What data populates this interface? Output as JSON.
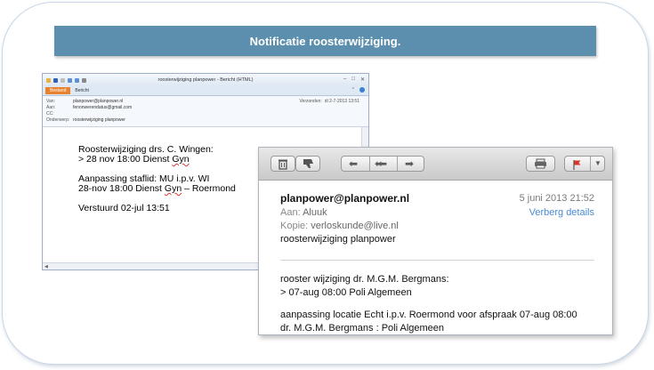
{
  "slide": {
    "title": "Notificatie roosterwijziging."
  },
  "outlook": {
    "window_title": "roosterwijziging planpower - Bericht (HTML)",
    "tabs": [
      "Bestand",
      "Bericht"
    ],
    "header": {
      "from_label": "Van:",
      "from_value": "planpower@planpower.nl",
      "to_label": "Aan:",
      "to_value": "fenonwerendatus@gmail.com",
      "cc_label": "CC:",
      "cc_value": "",
      "subject_label": "Onderwerp:",
      "subject_value": "roosterwijziging planpower",
      "sent_label": "Verzonden:",
      "sent_value": "di 2-7-2013 13:51"
    },
    "body": {
      "line1": "Roosterwijziging drs. C. Wingen:",
      "line2_pre": "> 28 nov 18:00 Dienst ",
      "line2_word": "Gyn",
      "line3": "Aanpassing staflid: MU i.p.v. WI",
      "line4_pre": "28-nov 18:00 Dienst ",
      "line4_word": "Gyn",
      "line4_post": " – Roermond",
      "line5": "Verstuurd 02-jul 13:51"
    },
    "icons": [
      "save-icon",
      "undo-icon",
      "redo-icon",
      "up-arrow-icon",
      "down-arrow-icon",
      "more-icon"
    ]
  },
  "mail": {
    "toolbar_icons": [
      "trash-icon",
      "thumbs-down-icon",
      "reply-icon",
      "reply-all-icon",
      "forward-icon",
      "print-icon",
      "flag-icon",
      "dropdown-icon"
    ],
    "from": "planpower@planpower.nl",
    "date": "5 juni 2013 21:52",
    "hide_details": "Verberg details",
    "to_label": "Aan:",
    "to_value": "Aluuk",
    "cc_label": "Kopie:",
    "cc_value": "verloskunde@live.nl",
    "subject": "roosterwijziging planpower",
    "body": {
      "line1": "rooster wijziging dr. M.G.M. Bergmans:",
      "line2": "> 07-aug 08:00 Poli Algemeen",
      "line3": "aanpassing locatie Echt i.p.v. Roermond voor afspraak 07-aug 08:00",
      "line4": "dr. M.G.M. Bergmans : Poli Algemeen"
    }
  },
  "colors": {
    "banner": "#5c8fad",
    "outlook_active_tab": "#e9822e",
    "link_blue": "#4a8bd6",
    "flag_red": "#d9342b"
  }
}
